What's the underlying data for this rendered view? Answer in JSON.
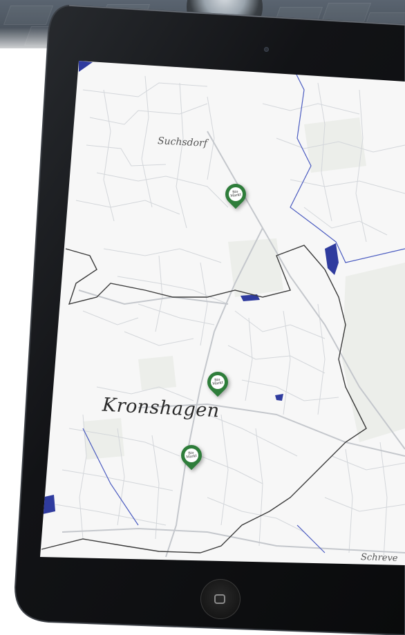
{
  "map": {
    "places": {
      "suchsdorf": "Suchsdorf",
      "kronshagen": "Kronshagen",
      "schreve": "Schreve"
    },
    "markers": [
      {
        "name": "store-marker-1",
        "logo": "Bio\nMarkt"
      },
      {
        "name": "store-marker-2",
        "logo": "Bio\nMarkt"
      },
      {
        "name": "store-marker-3",
        "logo": "Bio\nMarkt"
      }
    ],
    "colors": {
      "land": "#f7f7f7",
      "roads": "#c9ccd1",
      "boundary": "#3a3a3a",
      "water": "#2f3b9e",
      "marker": "#2e7d3a",
      "green_areas": "#e9ece8"
    }
  },
  "device": {
    "type": "tablet",
    "bezel_color": "#111214",
    "home_button_icon": "home-square-icon"
  }
}
